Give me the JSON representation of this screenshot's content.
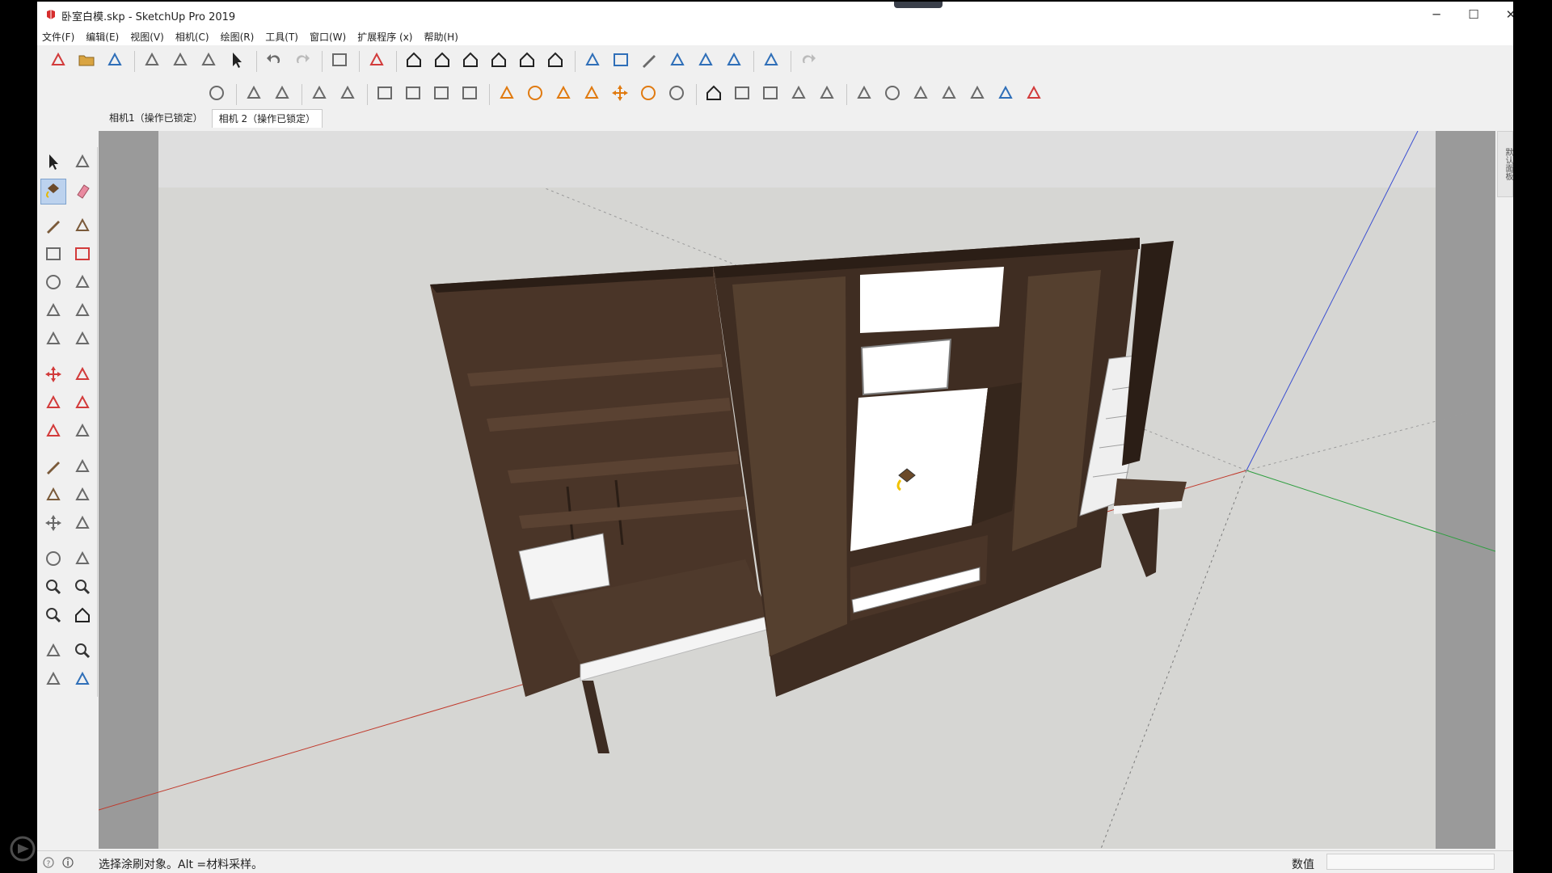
{
  "window": {
    "title": "卧室白模.skp - SketchUp Pro 2019",
    "minimize": "─",
    "maximize": "☐",
    "close": "✕"
  },
  "menubar": {
    "items": [
      "文件(F)",
      "编辑(E)",
      "视图(V)",
      "相机(C)",
      "绘图(R)",
      "工具(T)",
      "窗口(W)",
      "扩展程序 (x)",
      "帮助(H)"
    ]
  },
  "toolbar_row1": [
    "new-file-icon",
    "open-folder-icon",
    "save-icon",
    "sep",
    "cut-icon",
    "copy-icon",
    "paste-icon",
    "erase-selection-icon",
    "sep",
    "undo-icon",
    "redo-icon",
    "sep",
    "print-icon",
    "sep",
    "model-info-icon",
    "sep",
    "iso-view-icon",
    "top-view-icon",
    "front-view-icon",
    "right-view-icon",
    "back-view-icon",
    "left-view-icon",
    "sep",
    "xray-icon",
    "wireframe-icon",
    "hidden-line-icon",
    "shaded-icon",
    "shaded-textures-icon",
    "monochrome-icon",
    "sep",
    "section-plane-icon",
    "sep",
    "fredo-icon"
  ],
  "toolbar_row2": [
    "validate-icon",
    "sep",
    "teapot-icon",
    "teapot-group-icon",
    "sep",
    "landscape-icon",
    "terrain-icon",
    "sep",
    "frame-icon",
    "frame2-icon",
    "frame3-icon",
    "lock-icon",
    "sep",
    "joint-icon",
    "circle-target-icon",
    "triangle-tool-icon",
    "t-tool-icon",
    "explode-icon",
    "dome-icon",
    "sphere-icon",
    "sep",
    "roof-icon",
    "box-icon",
    "box2-icon",
    "grass-icon",
    "stripe-icon",
    "sep",
    "render-cam-icon",
    "render-sphere-icon",
    "render-light-icon",
    "render-cam2-icon",
    "render-paper-icon",
    "render-flag-icon",
    "render-stop-icon"
  ],
  "scenes": {
    "tabs": [
      "相机1（操作已锁定）",
      "相机 2（操作已锁定）"
    ],
    "active_index": 1
  },
  "left_toolbar": [
    "select-arrow-icon",
    "make-component-icon",
    "paint-bucket-icon",
    "eraser-icon",
    "gap",
    "pencil-line-icon",
    "freehand-icon",
    "rectangle-icon",
    "rotated-rectangle-icon",
    "circle-icon",
    "polygon-icon",
    "arc-icon",
    "two-point-arc-icon",
    "three-point-arc-icon",
    "pie-icon",
    "gap",
    "move-icon",
    "push-pull-icon",
    "rotate-icon",
    "follow-me-icon",
    "scale-icon",
    "offset-icon",
    "gap",
    "tape-measure-icon",
    "dimensions-icon",
    "protractor-icon",
    "text-label-icon",
    "axes-icon",
    "3d-text-icon",
    "gap",
    "orbit-icon",
    "pan-icon",
    "zoom-icon",
    "zoom-window-icon",
    "zoom-extents-icon",
    "previous-view-icon",
    "gap",
    "position-camera-icon",
    "look-around-icon",
    "walk-icon",
    "section-plane-tool-icon"
  ],
  "tray": {
    "label": "默认面板"
  },
  "statusbar": {
    "hint": "选择涂刷对象。Alt =材料采样。",
    "measure_label": "数值",
    "measure_value": ""
  },
  "colors": {
    "wood_dark": "#3d2c22",
    "wood_mid": "#4f3a2c",
    "wood_light": "#5e4535",
    "white_panel": "#ffffff",
    "viewport_bg": "#d6d6d3",
    "sky": "#dcdcda",
    "axis_red": "#c0392b",
    "axis_green": "#2e9e3f",
    "axis_blue": "#3b4fd1"
  }
}
